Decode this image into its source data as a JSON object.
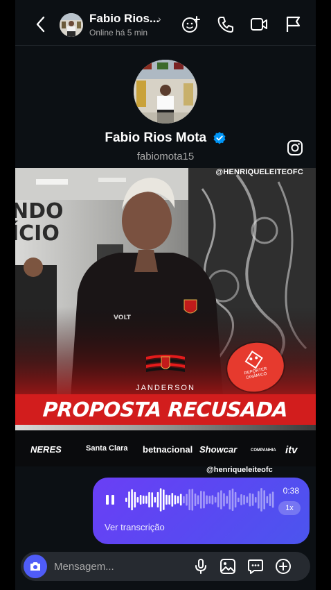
{
  "header": {
    "name": "Fabio Rios...",
    "status": "Online há 5 min",
    "chevron": "›"
  },
  "profile": {
    "name": "Fabio Rios Mota",
    "handle": "fabiomota15"
  },
  "post": {
    "watermark": "@HENRIQUELEITEOFC",
    "person_name": "JANDERSON",
    "headline": "PROPOSTA RECUSADA",
    "badge_text": "REPÓRTER DINÂMICO",
    "sponsors": [
      "NERES",
      "Santa Clara",
      "betnacional",
      "Showcar",
      "COMPANHIA",
      "itv"
    ],
    "handle_tag": "@henriqueleiteofc"
  },
  "voice_message": {
    "duration": "0:38",
    "speed": "1x",
    "transcription_label": "Ver transcrição"
  },
  "composer": {
    "placeholder": "Mensagem..."
  },
  "colors": {
    "background": "#0c1014",
    "bubble_start": "#6a3ff5",
    "bubble_end": "#4b55ee",
    "banner_red": "#d21d1d",
    "verified_blue": "#0095f6",
    "camera_blue": "#4f5cf7"
  },
  "icons": [
    "back-icon",
    "chevron-right-icon",
    "sticker-icon",
    "phone-icon",
    "video-icon",
    "flag-icon",
    "verified-icon",
    "instagram-icon",
    "pause-icon",
    "camera-icon",
    "microphone-icon",
    "gallery-icon",
    "chat-sticker-icon",
    "plus-icon"
  ]
}
